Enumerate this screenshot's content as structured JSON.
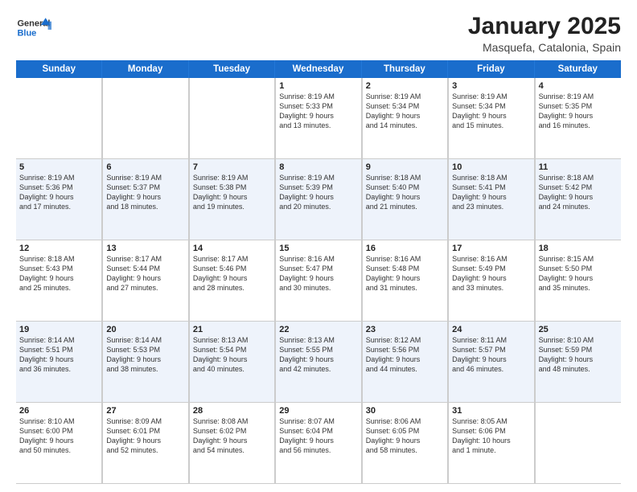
{
  "header": {
    "logo_general": "General",
    "logo_blue": "Blue",
    "month_title": "January 2025",
    "location": "Masquefa, Catalonia, Spain"
  },
  "weekdays": [
    "Sunday",
    "Monday",
    "Tuesday",
    "Wednesday",
    "Thursday",
    "Friday",
    "Saturday"
  ],
  "weeks": [
    [
      {
        "day": "",
        "info": ""
      },
      {
        "day": "",
        "info": ""
      },
      {
        "day": "",
        "info": ""
      },
      {
        "day": "1",
        "info": "Sunrise: 8:19 AM\nSunset: 5:33 PM\nDaylight: 9 hours\nand 13 minutes."
      },
      {
        "day": "2",
        "info": "Sunrise: 8:19 AM\nSunset: 5:34 PM\nDaylight: 9 hours\nand 14 minutes."
      },
      {
        "day": "3",
        "info": "Sunrise: 8:19 AM\nSunset: 5:34 PM\nDaylight: 9 hours\nand 15 minutes."
      },
      {
        "day": "4",
        "info": "Sunrise: 8:19 AM\nSunset: 5:35 PM\nDaylight: 9 hours\nand 16 minutes."
      }
    ],
    [
      {
        "day": "5",
        "info": "Sunrise: 8:19 AM\nSunset: 5:36 PM\nDaylight: 9 hours\nand 17 minutes."
      },
      {
        "day": "6",
        "info": "Sunrise: 8:19 AM\nSunset: 5:37 PM\nDaylight: 9 hours\nand 18 minutes."
      },
      {
        "day": "7",
        "info": "Sunrise: 8:19 AM\nSunset: 5:38 PM\nDaylight: 9 hours\nand 19 minutes."
      },
      {
        "day": "8",
        "info": "Sunrise: 8:19 AM\nSunset: 5:39 PM\nDaylight: 9 hours\nand 20 minutes."
      },
      {
        "day": "9",
        "info": "Sunrise: 8:18 AM\nSunset: 5:40 PM\nDaylight: 9 hours\nand 21 minutes."
      },
      {
        "day": "10",
        "info": "Sunrise: 8:18 AM\nSunset: 5:41 PM\nDaylight: 9 hours\nand 23 minutes."
      },
      {
        "day": "11",
        "info": "Sunrise: 8:18 AM\nSunset: 5:42 PM\nDaylight: 9 hours\nand 24 minutes."
      }
    ],
    [
      {
        "day": "12",
        "info": "Sunrise: 8:18 AM\nSunset: 5:43 PM\nDaylight: 9 hours\nand 25 minutes."
      },
      {
        "day": "13",
        "info": "Sunrise: 8:17 AM\nSunset: 5:44 PM\nDaylight: 9 hours\nand 27 minutes."
      },
      {
        "day": "14",
        "info": "Sunrise: 8:17 AM\nSunset: 5:46 PM\nDaylight: 9 hours\nand 28 minutes."
      },
      {
        "day": "15",
        "info": "Sunrise: 8:16 AM\nSunset: 5:47 PM\nDaylight: 9 hours\nand 30 minutes."
      },
      {
        "day": "16",
        "info": "Sunrise: 8:16 AM\nSunset: 5:48 PM\nDaylight: 9 hours\nand 31 minutes."
      },
      {
        "day": "17",
        "info": "Sunrise: 8:16 AM\nSunset: 5:49 PM\nDaylight: 9 hours\nand 33 minutes."
      },
      {
        "day": "18",
        "info": "Sunrise: 8:15 AM\nSunset: 5:50 PM\nDaylight: 9 hours\nand 35 minutes."
      }
    ],
    [
      {
        "day": "19",
        "info": "Sunrise: 8:14 AM\nSunset: 5:51 PM\nDaylight: 9 hours\nand 36 minutes."
      },
      {
        "day": "20",
        "info": "Sunrise: 8:14 AM\nSunset: 5:53 PM\nDaylight: 9 hours\nand 38 minutes."
      },
      {
        "day": "21",
        "info": "Sunrise: 8:13 AM\nSunset: 5:54 PM\nDaylight: 9 hours\nand 40 minutes."
      },
      {
        "day": "22",
        "info": "Sunrise: 8:13 AM\nSunset: 5:55 PM\nDaylight: 9 hours\nand 42 minutes."
      },
      {
        "day": "23",
        "info": "Sunrise: 8:12 AM\nSunset: 5:56 PM\nDaylight: 9 hours\nand 44 minutes."
      },
      {
        "day": "24",
        "info": "Sunrise: 8:11 AM\nSunset: 5:57 PM\nDaylight: 9 hours\nand 46 minutes."
      },
      {
        "day": "25",
        "info": "Sunrise: 8:10 AM\nSunset: 5:59 PM\nDaylight: 9 hours\nand 48 minutes."
      }
    ],
    [
      {
        "day": "26",
        "info": "Sunrise: 8:10 AM\nSunset: 6:00 PM\nDaylight: 9 hours\nand 50 minutes."
      },
      {
        "day": "27",
        "info": "Sunrise: 8:09 AM\nSunset: 6:01 PM\nDaylight: 9 hours\nand 52 minutes."
      },
      {
        "day": "28",
        "info": "Sunrise: 8:08 AM\nSunset: 6:02 PM\nDaylight: 9 hours\nand 54 minutes."
      },
      {
        "day": "29",
        "info": "Sunrise: 8:07 AM\nSunset: 6:04 PM\nDaylight: 9 hours\nand 56 minutes."
      },
      {
        "day": "30",
        "info": "Sunrise: 8:06 AM\nSunset: 6:05 PM\nDaylight: 9 hours\nand 58 minutes."
      },
      {
        "day": "31",
        "info": "Sunrise: 8:05 AM\nSunset: 6:06 PM\nDaylight: 10 hours\nand 1 minute."
      },
      {
        "day": "",
        "info": ""
      }
    ]
  ]
}
